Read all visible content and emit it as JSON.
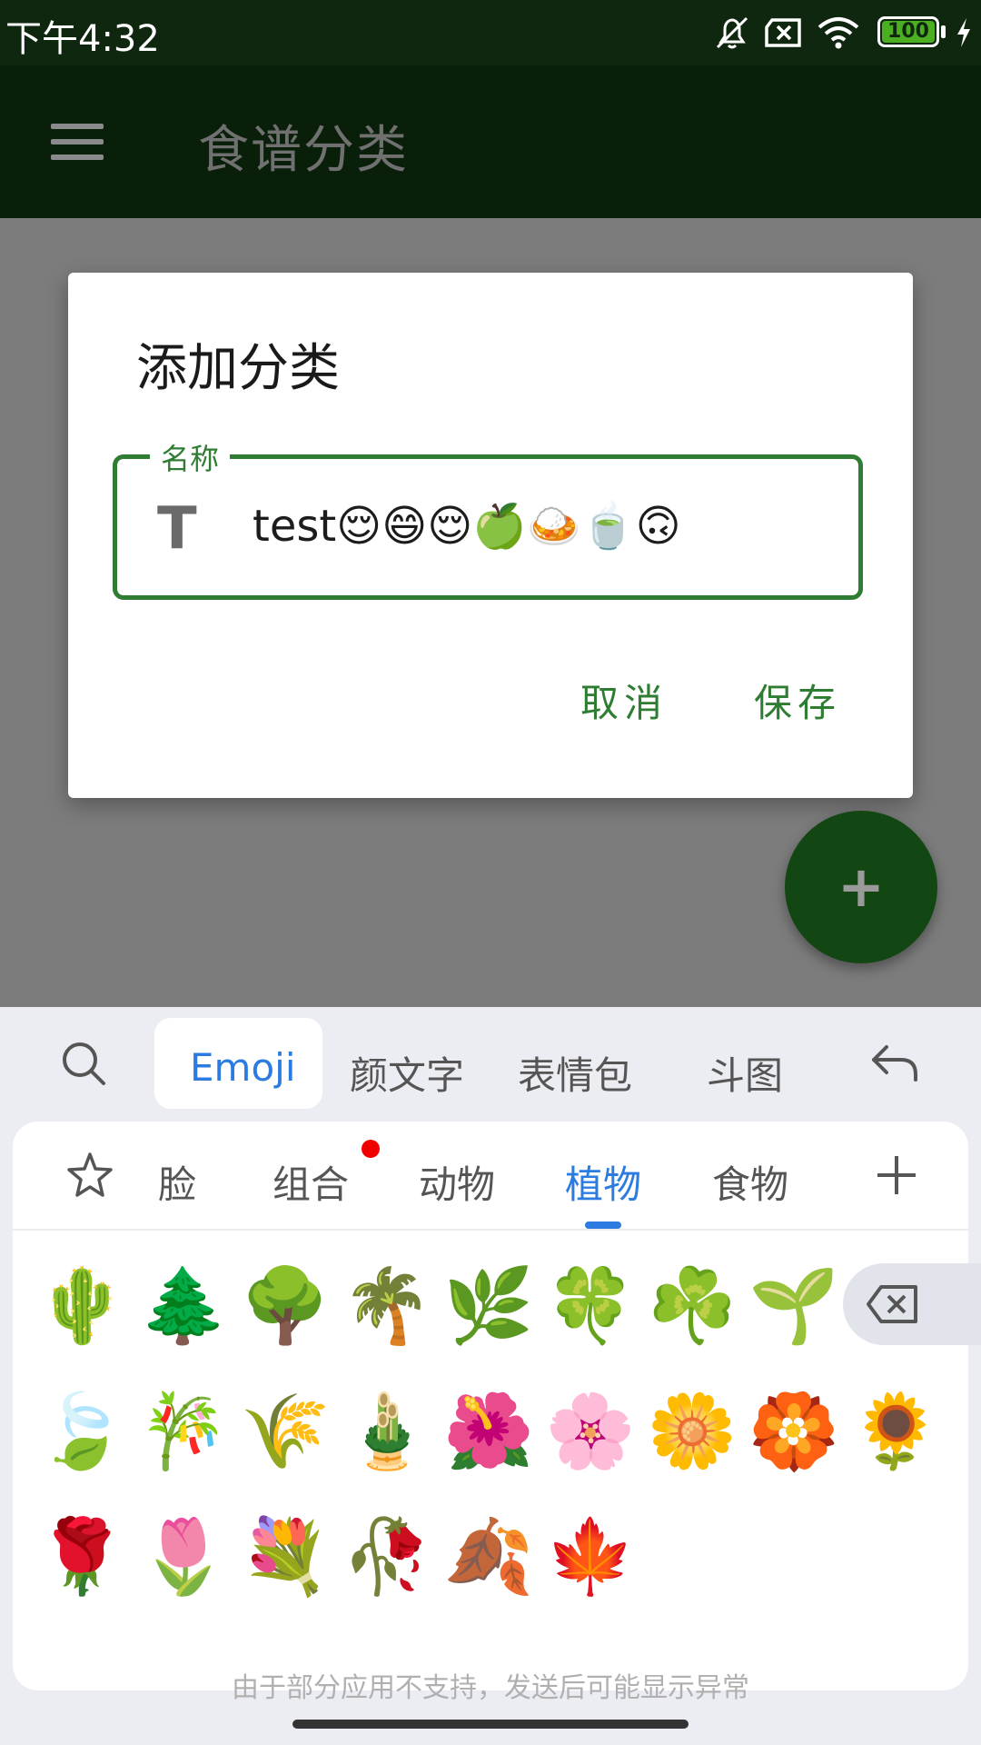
{
  "status_bar": {
    "time": "下午4:32",
    "battery": "100",
    "icons": [
      "bell-off-icon",
      "sim-x-icon",
      "wifi-icon",
      "battery-icon",
      "charging-icon"
    ]
  },
  "app_bar": {
    "menu_icon": "hamburger-menu-icon",
    "title": "食谱分类"
  },
  "dialog": {
    "title": "添加分类",
    "field_label": "名称",
    "field_icon_text": "T",
    "field_value": "test😌😄😌🍏🍛🍵🙃",
    "cancel_label": "取消",
    "save_label": "保存"
  },
  "fab": {
    "icon": "plus-icon",
    "glyph": "+"
  },
  "keyboard": {
    "tabs": [
      "Emoji",
      "颜文字",
      "表情包",
      "斗图"
    ],
    "active_tab": "Emoji",
    "search_icon": "search-icon",
    "back_icon": "undo-icon",
    "categories": [
      "脸",
      "组合",
      "动物",
      "植物",
      "食物"
    ],
    "active_category": "植物",
    "favorite_icon": "star-icon",
    "add_icon": "plus-icon",
    "delete_icon": "backspace-icon",
    "emojis": [
      [
        "🌵",
        "🌲",
        "🌳",
        "🌴",
        "🌿",
        "🍀",
        "☘️",
        "🌱"
      ],
      [
        "🍃",
        "🎋",
        "🌾",
        "🎍",
        "🌺",
        "🌸",
        "🌼",
        "🏵️",
        "🌻"
      ],
      [
        "🌹",
        "🌷",
        "💐",
        "🥀",
        "🍂",
        "🍁"
      ]
    ],
    "hint": "由于部分应用不支持，发送后可能显示异常"
  },
  "colors": {
    "app_bar": "#144614",
    "accent_green": "#2f7d32",
    "keyboard_accent": "#2b7be0"
  }
}
